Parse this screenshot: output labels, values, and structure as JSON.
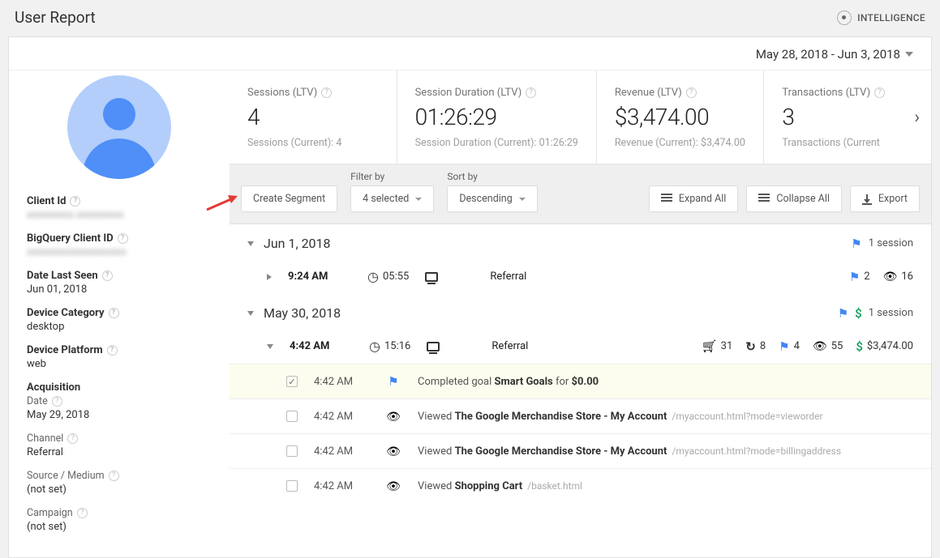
{
  "header": {
    "title": "User Report",
    "intelligence": "INTELLIGENCE"
  },
  "date_range": "May 28, 2018 - Jun 3, 2018",
  "sidebar": {
    "client_id_label": "Client Id",
    "client_id_value": "xxxxxxxxx.xxxxxxxxx",
    "bq_label": "BigQuery Client ID",
    "bq_value": "xxxxxxxxxxxxxxxxxxx",
    "date_last_seen_label": "Date Last Seen",
    "date_last_seen_value": "Jun 01, 2018",
    "device_category_label": "Device Category",
    "device_category_value": "desktop",
    "device_platform_label": "Device Platform",
    "device_platform_value": "web",
    "acquisition_label": "Acquisition",
    "acq_date_label": "Date",
    "acq_date_value": "May 29, 2018",
    "acq_channel_label": "Channel",
    "acq_channel_value": "Referral",
    "acq_source_label": "Source / Medium",
    "acq_source_value": "(not set)",
    "acq_campaign_label": "Campaign",
    "acq_campaign_value": "(not set)"
  },
  "kpis": {
    "sessions": {
      "title": "Sessions (LTV)",
      "value": "4",
      "sub": "Sessions (Current): 4"
    },
    "duration": {
      "title": "Session Duration (LTV)",
      "value": "01:26:29",
      "sub": "Session Duration (Current): 01:26:29"
    },
    "revenue": {
      "title": "Revenue (LTV)",
      "value": "$3,474.00",
      "sub": "Revenue (Current): $3,474.00"
    },
    "transactions": {
      "title": "Transactions (LTV)",
      "value": "3",
      "sub": "Transactions (Current"
    }
  },
  "toolbar": {
    "create_segment": "Create Segment",
    "filter_label": "Filter by",
    "filter_value": "4 selected",
    "sort_label": "Sort by",
    "sort_value": "Descending",
    "expand_all": "Expand All",
    "collapse_all": "Collapse All",
    "export": "Export"
  },
  "days": [
    {
      "date": "Jun 1, 2018",
      "expanded": true,
      "summary_text": "1 session",
      "summary_icons": [
        "flag"
      ],
      "sessions": [
        {
          "expanded": false,
          "time": "9:24 AM",
          "duration": "05:55",
          "channel": "Referral",
          "stats": {
            "flag": "2",
            "eye": "16"
          }
        }
      ]
    },
    {
      "date": "May 30, 2018",
      "expanded": true,
      "summary_text": "1 session",
      "summary_icons": [
        "flag",
        "dollar"
      ],
      "sessions": [
        {
          "expanded": true,
          "time": "4:42 AM",
          "duration": "15:16",
          "channel": "Referral",
          "stats": {
            "cart": "31",
            "refresh": "8",
            "flag": "4",
            "eye": "55",
            "dollar": "$3,474.00"
          },
          "events": [
            {
              "checked": true,
              "time": "4:42 AM",
              "icon": "flag",
              "highlight": true,
              "prefix": "Completed goal ",
              "bold": "Smart Goals",
              "suffix": " for ",
              "bold2": "$0.00",
              "path": ""
            },
            {
              "checked": false,
              "time": "4:42 AM",
              "icon": "eye",
              "prefix": "Viewed ",
              "bold": "The Google Merchandise Store - My Account",
              "suffix": "",
              "path": "/myaccount.html?mode=vieworder"
            },
            {
              "checked": false,
              "time": "4:42 AM",
              "icon": "eye",
              "prefix": "Viewed ",
              "bold": "The Google Merchandise Store - My Account",
              "suffix": "",
              "path": "/myaccount.html?mode=billingaddress"
            },
            {
              "checked": false,
              "time": "4:42 AM",
              "icon": "eye",
              "prefix": "Viewed ",
              "bold": "Shopping Cart",
              "suffix": "",
              "path": "/basket.html"
            }
          ]
        }
      ]
    }
  ]
}
